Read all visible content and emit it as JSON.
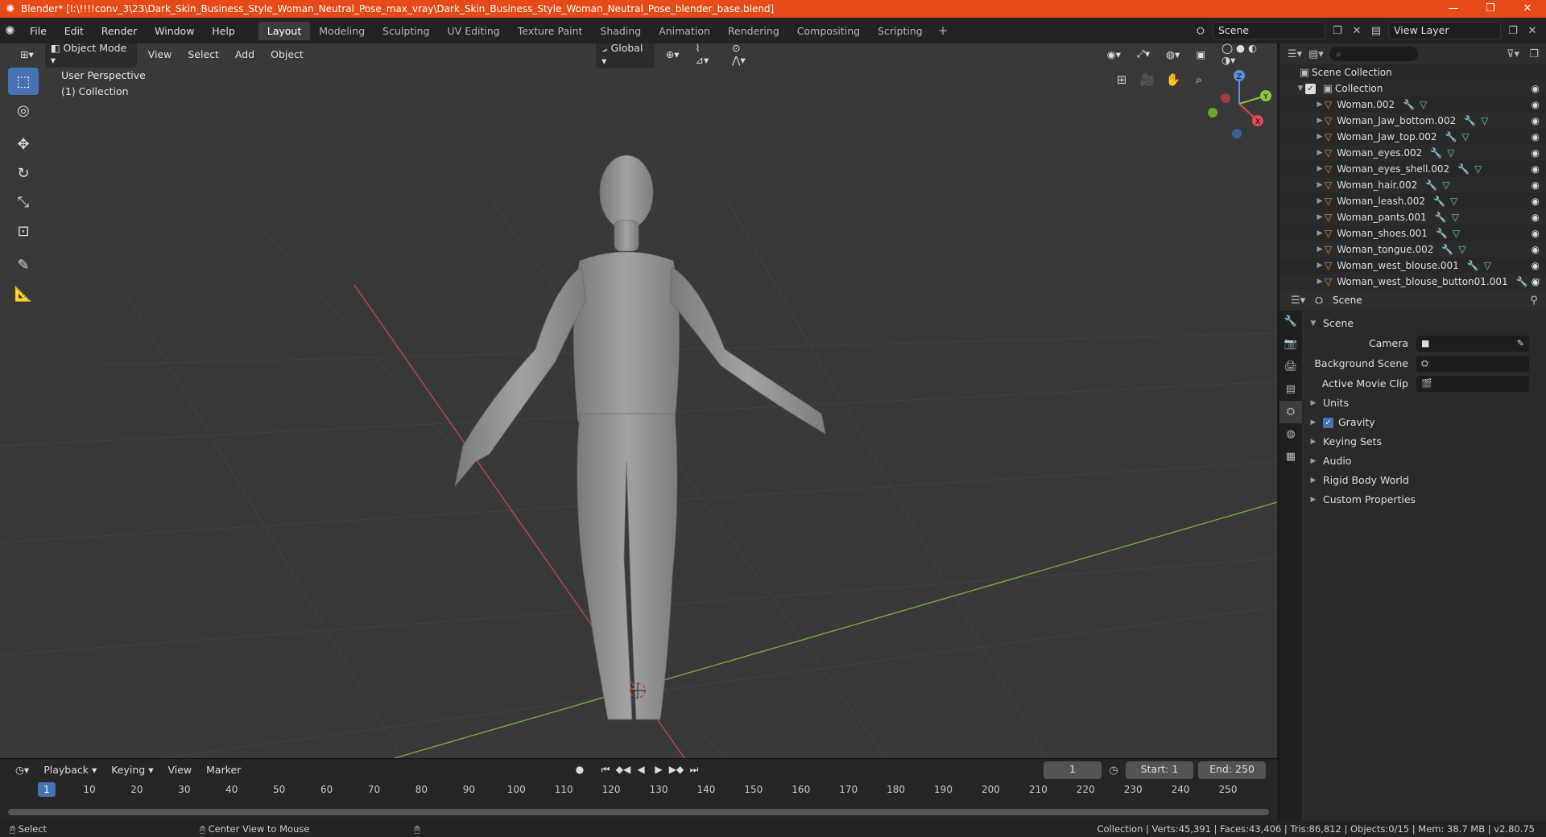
{
  "window": {
    "title": "Blender* [I:\\!!!!conv_3\\23\\Dark_Skin_Business_Style_Woman_Neutral_Pose_max_vray\\Dark_Skin_Business_Style_Woman_Neutral_Pose_blender_base.blend]",
    "controls": [
      "—",
      "❐",
      "✕"
    ]
  },
  "menu": [
    "File",
    "Edit",
    "Render",
    "Window",
    "Help"
  ],
  "workspaces": [
    "Layout",
    "Modeling",
    "Sculpting",
    "UV Editing",
    "Texture Paint",
    "Shading",
    "Animation",
    "Rendering",
    "Compositing",
    "Scripting"
  ],
  "active_workspace": "Layout",
  "scene_field": "Scene",
  "view_layer_field": "View Layer",
  "viewport": {
    "mode": "Object Mode",
    "menus": [
      "View",
      "Select",
      "Add",
      "Object"
    ],
    "orientation": "Global",
    "overlay_title": "User Perspective",
    "overlay_collection": "(1) Collection",
    "gizmo": {
      "x": "X",
      "y": "Y",
      "z": "Z"
    }
  },
  "timeline": {
    "menus": [
      "Playback",
      "Keying",
      "View",
      "Marker"
    ],
    "current_frame": "1",
    "start_label": "Start:",
    "start_value": "1",
    "end_label": "End:",
    "end_value": "250",
    "ruler": [
      "1",
      "10",
      "20",
      "30",
      "40",
      "50",
      "60",
      "70",
      "80",
      "90",
      "100",
      "110",
      "120",
      "130",
      "140",
      "150",
      "160",
      "170",
      "180",
      "190",
      "200",
      "210",
      "220",
      "230",
      "240",
      "250"
    ]
  },
  "status": {
    "left": "Select",
    "middle": "Center View to Mouse",
    "right": "Collection | Verts:45,391 | Faces:43,406 | Tris:86,812 | Objects:0/15 | Mem: 38.7 MB | v2.80.75"
  },
  "outliner": {
    "root": "Scene Collection",
    "collection": "Collection",
    "items": [
      "Woman.002",
      "Woman_Jaw_bottom.002",
      "Woman_Jaw_top.002",
      "Woman_eyes.002",
      "Woman_eyes_shell.002",
      "Woman_hair.002",
      "Woman_leash.002",
      "Woman_pants.001",
      "Woman_shoes.001",
      "Woman_tongue.002",
      "Woman_west_blouse.001",
      "Woman_west_blouse_button01.001"
    ]
  },
  "properties": {
    "context": "Scene",
    "panel": "Scene",
    "camera_label": "Camera",
    "background_scene_label": "Background Scene",
    "active_clip_label": "Active Movie Clip",
    "sections": [
      "Units",
      "Gravity",
      "Keying Sets",
      "Audio",
      "Rigid Body World",
      "Custom Properties"
    ]
  }
}
